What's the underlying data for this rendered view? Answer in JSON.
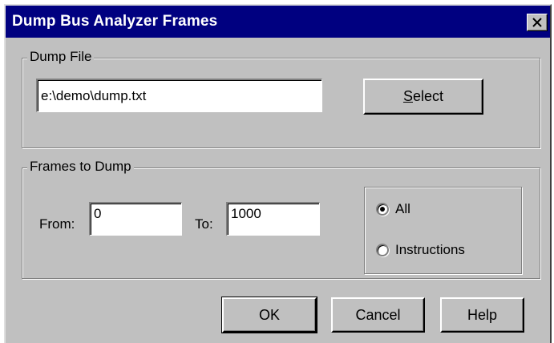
{
  "window": {
    "title": "Dump Bus Analyzer Frames",
    "close_icon": "close-icon"
  },
  "dump_file": {
    "group_label": "Dump File",
    "path_value": "e:\\demo\\dump.txt",
    "select_label_first": "S",
    "select_label_rest": "elect"
  },
  "frames": {
    "group_label": "Frames to Dump",
    "from_label": "From:",
    "from_value": "0",
    "to_label": "To:",
    "to_value": "1000",
    "options": [
      {
        "label": "All",
        "selected": true
      },
      {
        "label": "Instructions",
        "selected": false
      }
    ]
  },
  "buttons": {
    "ok": "OK",
    "cancel": "Cancel",
    "help": "Help"
  }
}
